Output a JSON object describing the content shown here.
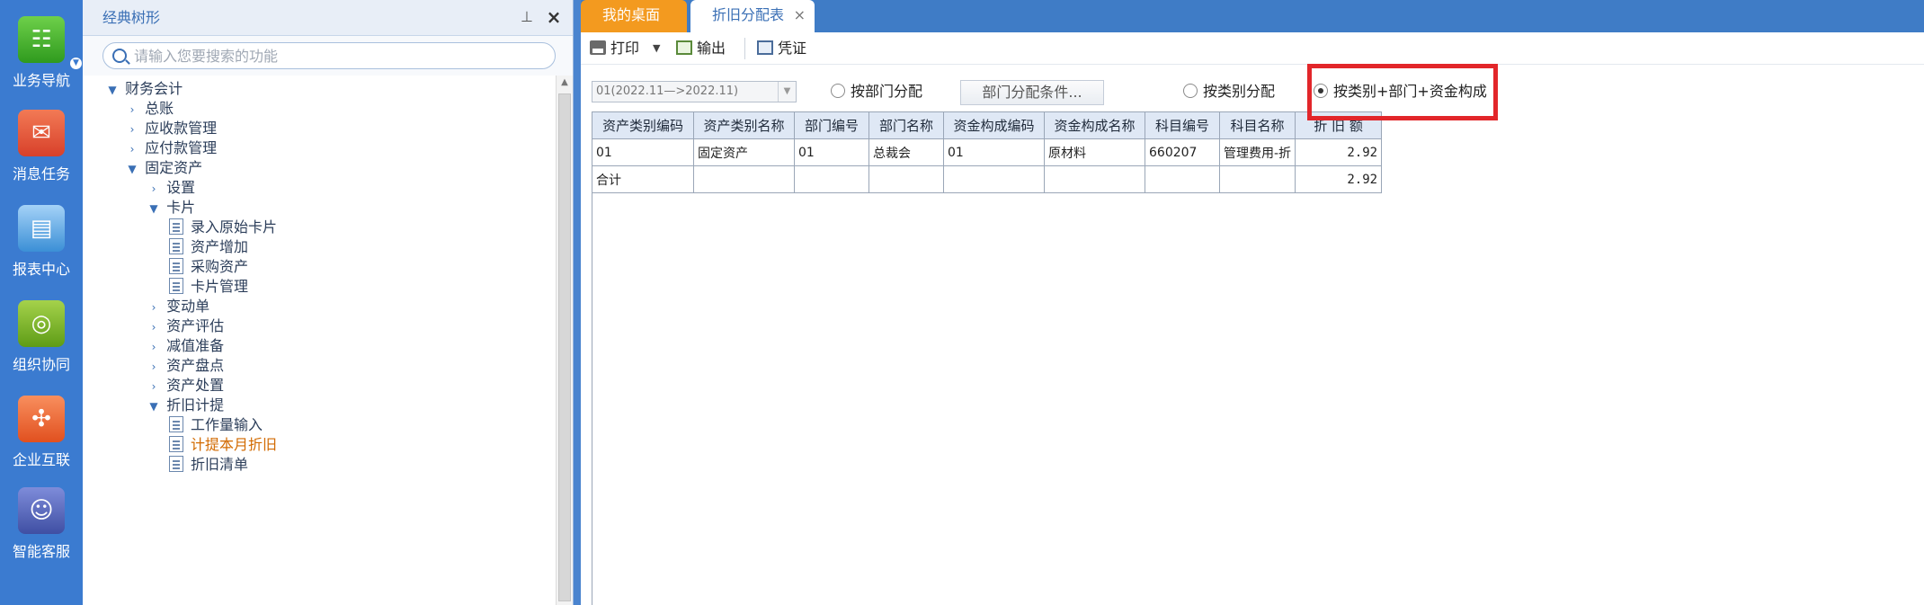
{
  "iconbar": {
    "items": [
      {
        "label": "业务导航",
        "icon": "business-nav-icon"
      },
      {
        "label": "消息任务",
        "icon": "message-task-icon"
      },
      {
        "label": "报表中心",
        "icon": "report-center-icon"
      },
      {
        "label": "组织协同",
        "icon": "org-collab-icon"
      },
      {
        "label": "企业互联",
        "icon": "enterprise-link-icon"
      },
      {
        "label": "智能客服",
        "icon": "smart-service-icon"
      }
    ]
  },
  "tree_panel": {
    "title": "经典树形",
    "search_placeholder": "请输入您要搜索的功能",
    "nodes": [
      {
        "label": "财务会计",
        "state": "expanded"
      },
      {
        "label": "总账",
        "state": "collapsed"
      },
      {
        "label": "应收款管理",
        "state": "collapsed"
      },
      {
        "label": "应付款管理",
        "state": "collapsed"
      },
      {
        "label": "固定资产",
        "state": "expanded"
      },
      {
        "label": "设置",
        "state": "collapsed"
      },
      {
        "label": "卡片",
        "state": "expanded"
      },
      {
        "label": "录入原始卡片",
        "state": "leaf"
      },
      {
        "label": "资产增加",
        "state": "leaf"
      },
      {
        "label": "采购资产",
        "state": "leaf"
      },
      {
        "label": "卡片管理",
        "state": "leaf"
      },
      {
        "label": "变动单",
        "state": "collapsed"
      },
      {
        "label": "资产评估",
        "state": "collapsed"
      },
      {
        "label": "减值准备",
        "state": "collapsed"
      },
      {
        "label": "资产盘点",
        "state": "collapsed"
      },
      {
        "label": "资产处置",
        "state": "collapsed"
      },
      {
        "label": "折旧计提",
        "state": "expanded"
      },
      {
        "label": "工作量输入",
        "state": "leaf"
      },
      {
        "label": "计提本月折旧",
        "state": "leaf-active"
      },
      {
        "label": "折旧清单",
        "state": "leaf"
      }
    ]
  },
  "tabs": {
    "desktop": "我的桌面",
    "report": "折旧分配表",
    "close_glyph": "×"
  },
  "toolbar": {
    "print": "打印",
    "export": "输出",
    "voucher": "凭证"
  },
  "filters": {
    "period": "01(2022.11—>2022.11)",
    "radio_dept": "按部门分配",
    "dept_condition_button": "部门分配条件...",
    "radio_category": "按类别分配",
    "radio_combo": "按类别+部门+资金构成",
    "selected": "radio_combo"
  },
  "table": {
    "headers": [
      "资产类别编码",
      "资产类别名称",
      "部门编号",
      "部门名称",
      "资金构成编码",
      "资金构成名称",
      "科目编号",
      "科目名称",
      "折 旧 额"
    ],
    "rows": [
      [
        "01",
        "固定资产",
        "01",
        "总裁会",
        "01",
        "原材料",
        "660207",
        "管理费用-折",
        "2.92"
      ]
    ],
    "total_row": [
      "合计",
      "",
      "",
      "",
      "",
      "",
      "",
      "",
      "2.92"
    ]
  },
  "colors": {
    "accent_blue": "#3f7cc6",
    "tab_orange": "#f39a1f",
    "highlight_red": "#e2262a",
    "active_tree_item": "#d26a00"
  }
}
